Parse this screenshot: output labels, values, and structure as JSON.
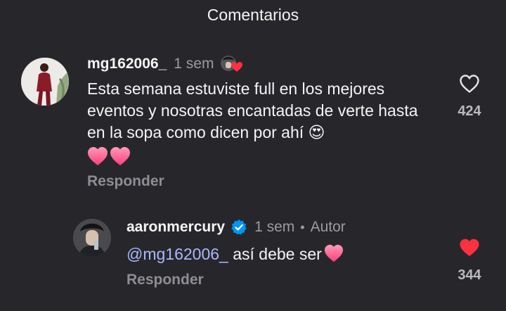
{
  "header": {
    "title": "Comentarios"
  },
  "comments": [
    {
      "username": "mg162006_",
      "time": "1 sem",
      "text": "Esta semana estuviste full en los mejores eventos y nosotras encantadas de verte hasta en la sopa como dicen por ahí 😍",
      "reply_label": "Responder",
      "like_count": "424",
      "liked": false,
      "avatar_icon": "profile-photo-woman"
    },
    {
      "username": "aaronmercury",
      "time": "1 sem",
      "author_label": "Autor",
      "mention": "@mg162006_",
      "text": "así debe ser",
      "reply_label": "Responder",
      "like_count": "344",
      "liked": true,
      "avatar_icon": "profile-photo-man"
    }
  ],
  "colors": {
    "background": "#27272b",
    "mention": "#a9b8ff",
    "heart_red": "#ff3040",
    "verified_blue": "#0095f6"
  }
}
